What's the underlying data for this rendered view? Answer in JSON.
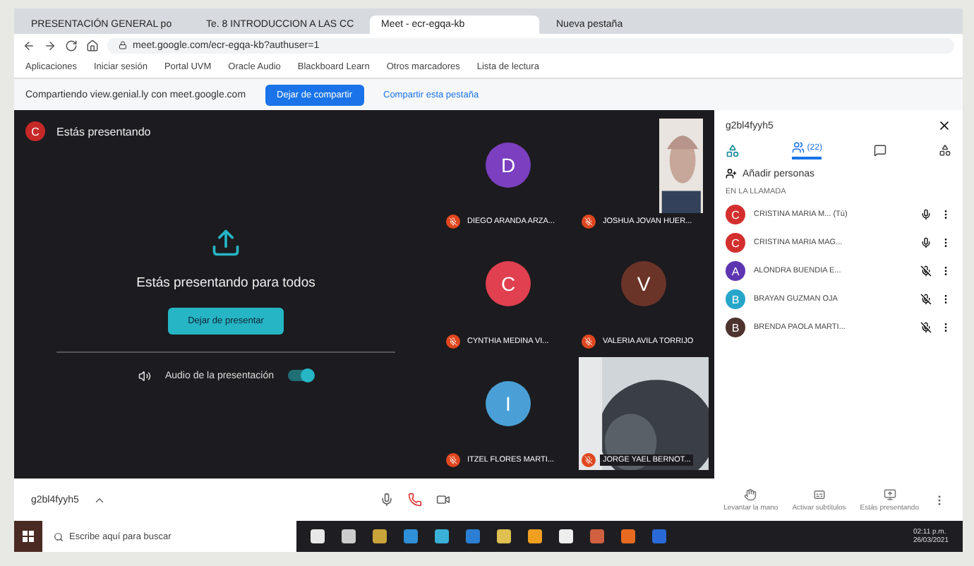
{
  "browser": {
    "tabs": [
      {
        "label": "PRESENTACIÓN GENERAL po",
        "selected": false
      },
      {
        "label": "Te. 8 INTRODUCCION A LAS CC",
        "selected": false
      },
      {
        "label": "Meet - ecr-egqa-kb",
        "selected": true
      },
      {
        "label": "Nueva pestaña",
        "selected": false
      }
    ],
    "address": "meet.google.com/ecr-egqa-kb?authuser=1",
    "bookmarks": [
      "Aplicaciones",
      "Iniciar sesión",
      "Portal UVM",
      "Oracle Audio",
      "Blackboard Learn",
      "Otros marcadores",
      "Lista de lectura"
    ]
  },
  "share_banner": {
    "text": "Compartiendo view.genial.ly con meet.google.com",
    "button": "Dejar de compartir",
    "link": "Compartir esta pestaña"
  },
  "presenting": {
    "badge": "C",
    "title": "Estás presentando",
    "message": "Estás presentando para todos",
    "button": "Dejar de presentar",
    "audio_label": "Audio de la presentación",
    "audio_on": true
  },
  "tiles": [
    {
      "name": "DIEGO ARANDA ARZA...",
      "initial": "D",
      "color": "#7b3fbf",
      "kind": "avatar"
    },
    {
      "name": "JOSHUA JOVAN HUER...",
      "kind": "picture"
    },
    {
      "name": "CYNTHIA MEDINA VI...",
      "initial": "C",
      "color": "#e0404f",
      "kind": "avatar"
    },
    {
      "name": "VALERIA AVILA TORRIJO",
      "initial": "V",
      "color": "#6b3428",
      "kind": "avatar"
    },
    {
      "name": "ITZEL FLORES MARTI...",
      "initial": "I",
      "color": "#4aa0d6",
      "kind": "avatar"
    },
    {
      "name": "JORGE YAEL BERNOT...",
      "kind": "picture"
    }
  ],
  "panel": {
    "code": "g2bl4fyyh5",
    "tab_count": "(22)",
    "add_people": "Añadir personas",
    "section": "EN LA LLAMADA",
    "people": [
      {
        "initial": "C",
        "name": "CRISTINA MARIA M... (Tú)",
        "color": "#d32f2f"
      },
      {
        "initial": "C",
        "name": "CRISTINA MARIA MAG...",
        "color": "#d32f2f"
      },
      {
        "initial": "A",
        "name": "ALONDRA BUENDIA E...",
        "color": "#5e35b1"
      },
      {
        "initial": "B",
        "name": "BRAYAN GUZMAN OJA",
        "color": "#26a6c9"
      },
      {
        "initial": "B",
        "name": "BRENDA PAOLA MARTI...",
        "color": "#4e342e"
      }
    ]
  },
  "bottom": {
    "code": "g2bl4fyyh5",
    "actions": [
      "Levantar la mano",
      "Activar subtítulos",
      "Estás presentando"
    ]
  },
  "taskbar": {
    "search": "Escribe aquí para buscar",
    "time": "02:11 p.m.",
    "date": "26/03/2021"
  }
}
